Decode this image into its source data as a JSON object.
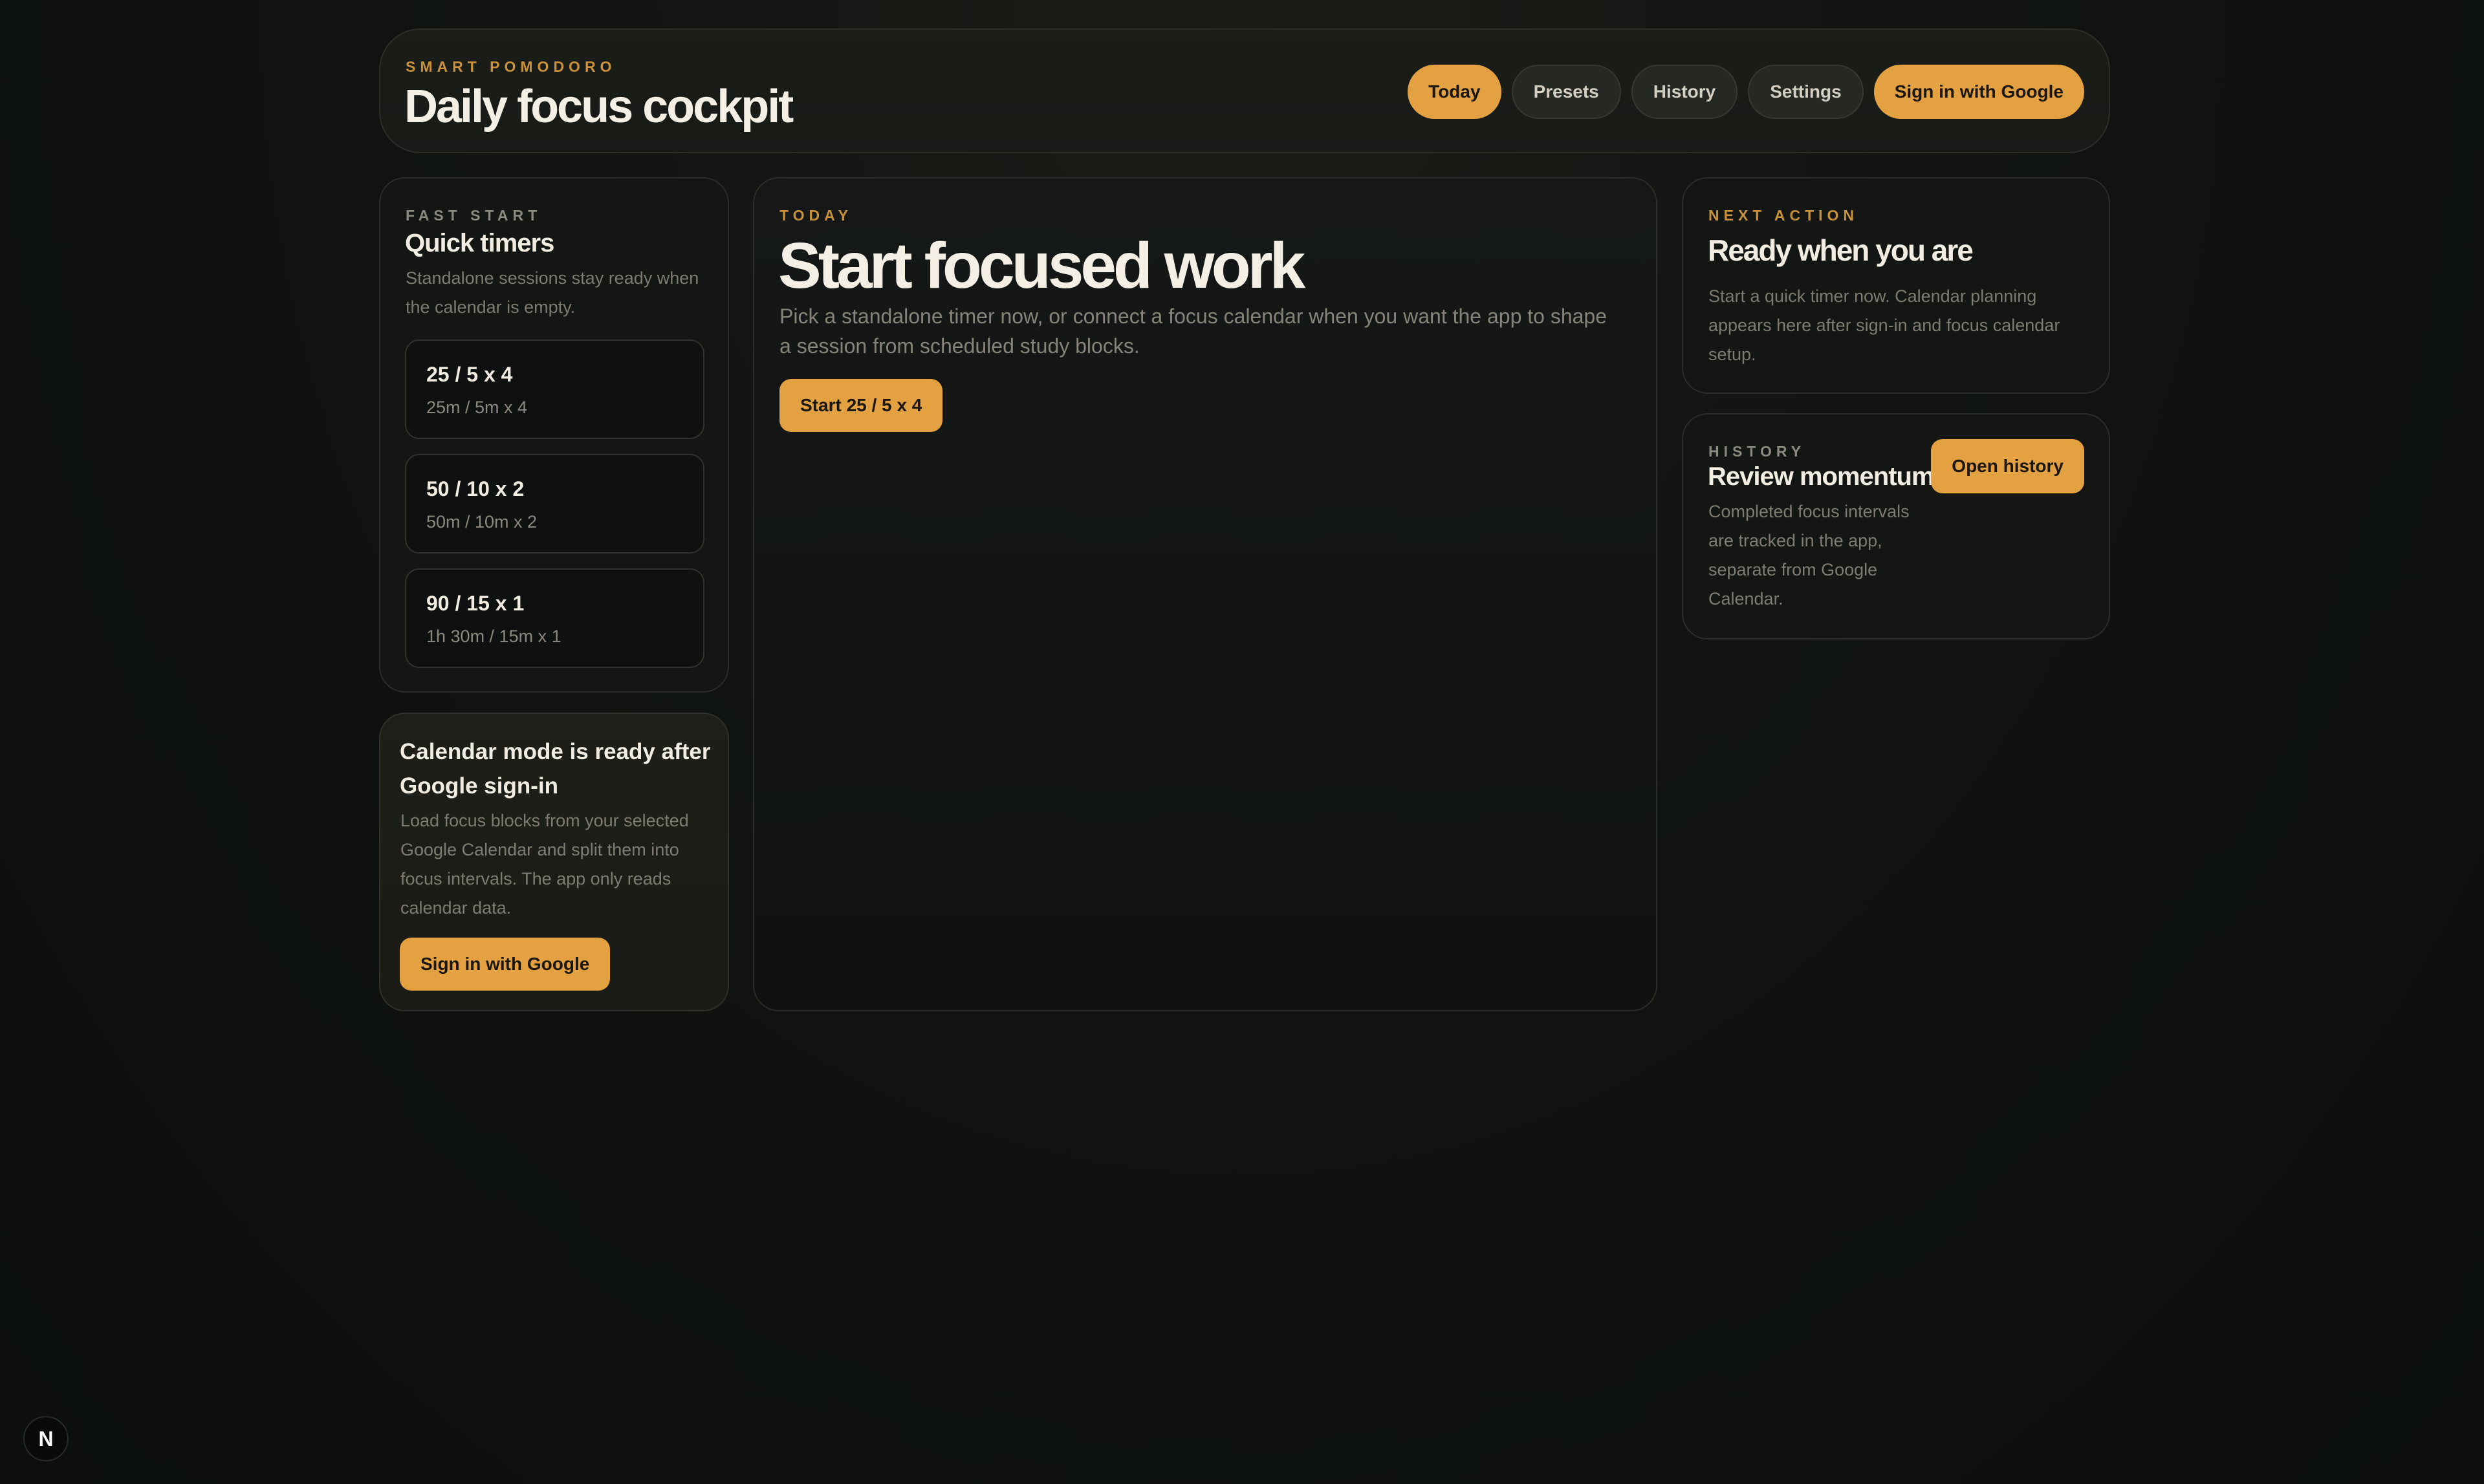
{
  "header": {
    "eyebrow": "SMART POMODORO",
    "title": "Daily focus cockpit",
    "nav": {
      "today": "Today",
      "presets": "Presets",
      "history": "History",
      "settings": "Settings",
      "sign_in": "Sign in with Google"
    },
    "active_tab": "Today"
  },
  "quick_timers": {
    "eyebrow": "FAST START",
    "title": "Quick timers",
    "description": "Standalone sessions stay ready when the calendar is empty.",
    "items": [
      {
        "title": "25 / 5 x 4",
        "subtitle": "25m / 5m x 4"
      },
      {
        "title": "50 / 10 x 2",
        "subtitle": "50m / 10m x 2"
      },
      {
        "title": "90 / 15 x 1",
        "subtitle": "1h 30m / 15m x 1"
      }
    ]
  },
  "calendar_mode": {
    "title": "Calendar mode is ready after Google sign-in",
    "description": "Load focus blocks from your selected Google Calendar and split them into focus intervals. The app only reads calendar data.",
    "button": "Sign in with Google"
  },
  "today": {
    "eyebrow": "TODAY",
    "title": "Start focused work",
    "description": "Pick a standalone timer now, or connect a focus calendar when you want the app to shape a session from scheduled study blocks.",
    "button": "Start 25 / 5 x 4"
  },
  "next_action": {
    "eyebrow": "NEXT ACTION",
    "title": "Ready when you are",
    "description": "Start a quick timer now. Calendar planning appears here after sign-in and focus calendar setup."
  },
  "history_card": {
    "eyebrow": "HISTORY",
    "title": "Review momentum",
    "description": "Completed focus intervals are tracked in the app, separate from Google Calendar.",
    "button": "Open history"
  },
  "dev_badge": {
    "label": "N"
  },
  "colors": {
    "accent": "#e3a142",
    "eyebrow": "#c8913a",
    "background": "#0c0f0e"
  }
}
